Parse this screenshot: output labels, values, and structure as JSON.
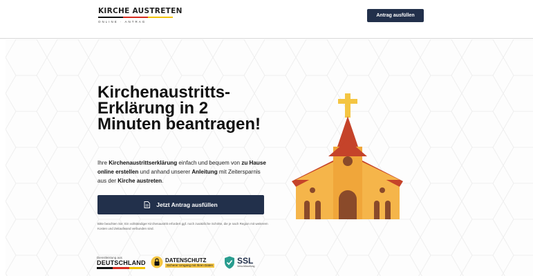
{
  "header": {
    "logo_title": "KIRCHE AUSTRETEN",
    "logo_subtitle": "ONLINE · ANTRAG",
    "logo_bar_colors": [
      "#111111",
      "#d52b1e",
      "#f2c200"
    ],
    "cta_label": "Antrag ausfüllen"
  },
  "hero": {
    "headline": "Kirchenaustritts-Erklärung in 2 Minuten beantragen!",
    "description": {
      "p1": "Ihre ",
      "b1": "Kirchenaustrittserklärung",
      "p2": " einfach und bequem von ",
      "b2": "zu Hause online erstellen",
      "p3": " und anhand unserer ",
      "b3": "Anleitung",
      "p4": " mit Zeitersparnis aus der ",
      "b4": "Kirche austreten",
      "p5": "."
    },
    "cta_label": "Jetzt Antrag ausfüllen",
    "cta_icon": "document-icon",
    "note": "Bitte beachten Sie: Ein vollständiger Kirchenaustritt erfordert ggf. noch zusätzliche Schritte, die je nach Region mit weiterem Kosten und Zeitaufwand verbunden sind."
  },
  "badges": {
    "germany_small": "Dienstleistung aus",
    "germany_big": "DEUTSCHLAND",
    "privacy_title": "DATENSCHUTZ",
    "privacy_sub": "Sicherer Umgang mit Ihren Daten",
    "ssl_title": "SSL",
    "ssl_sub": "Verschlüsselung"
  },
  "colors": {
    "navy": "#22304b",
    "church_orange": "#f0a63a",
    "church_red": "#c5432a",
    "church_brown": "#8a4a2a",
    "cross_yellow": "#f4c542"
  }
}
